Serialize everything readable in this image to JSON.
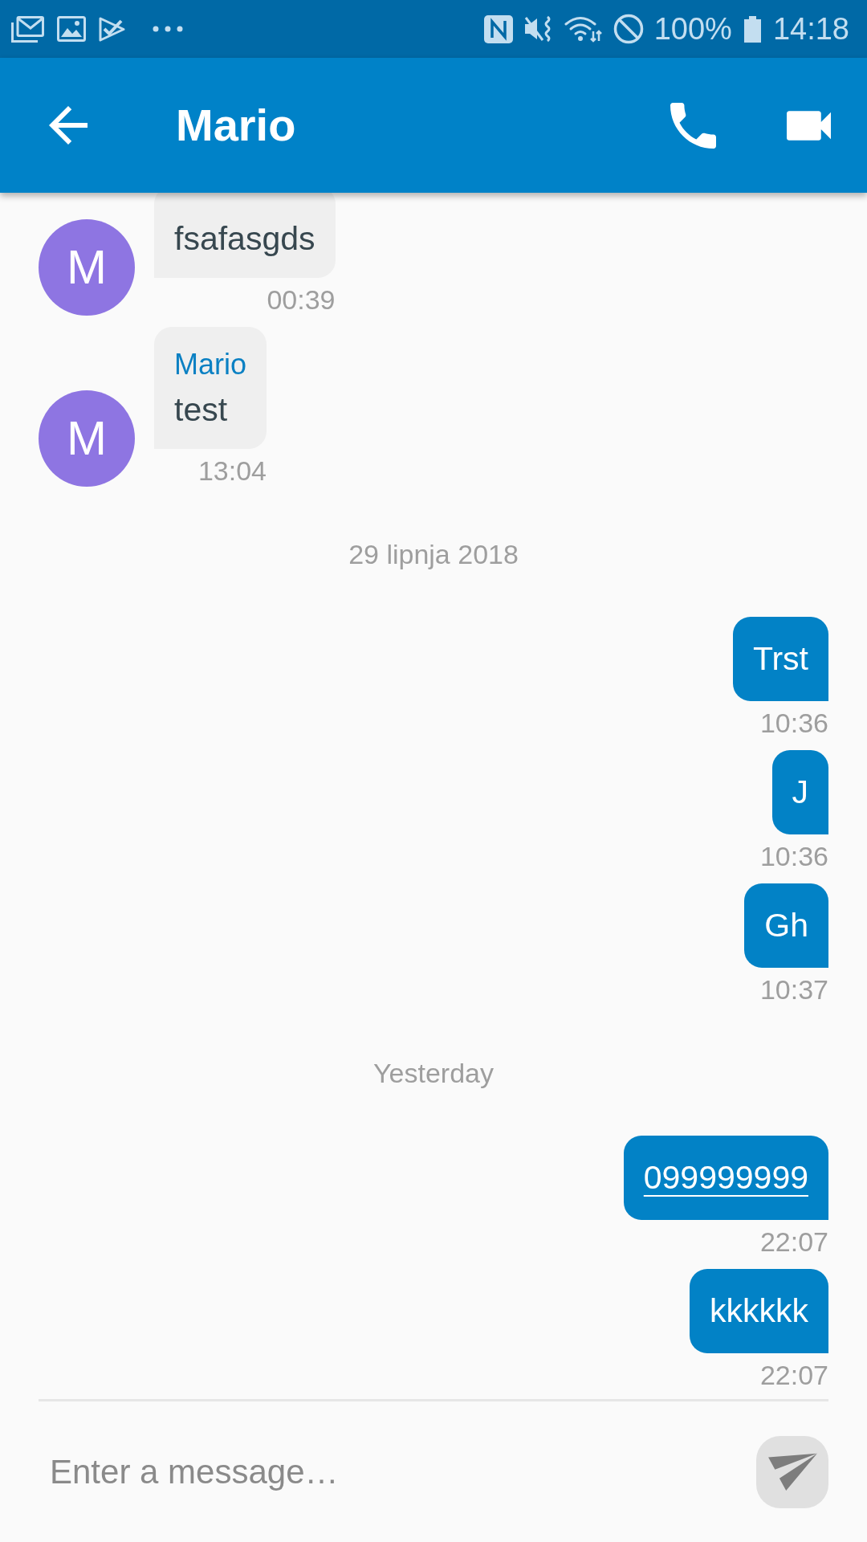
{
  "status_bar": {
    "battery": "100%",
    "time": "14:18"
  },
  "app_bar": {
    "title": "Mario"
  },
  "messages": [
    {
      "kind": "received",
      "avatar": "M",
      "text": "fsafasgds",
      "time": "00:39"
    },
    {
      "kind": "received",
      "avatar": "M",
      "sender": "Mario",
      "text": "test",
      "time": "13:04"
    },
    {
      "kind": "date",
      "text": "29 lipnja 2018"
    },
    {
      "kind": "sent",
      "text": "Trst",
      "time": "10:36",
      "link": false
    },
    {
      "kind": "sent",
      "text": "J",
      "time": "10:36",
      "link": false
    },
    {
      "kind": "sent",
      "text": "Gh",
      "time": "10:37",
      "link": false
    },
    {
      "kind": "date",
      "text": "Yesterday"
    },
    {
      "kind": "sent",
      "text": "099999999",
      "time": "22:07",
      "link": true
    },
    {
      "kind": "sent",
      "text": "kkkkkk",
      "time": "22:07",
      "link": false
    }
  ],
  "composer": {
    "placeholder": "Enter a message…"
  }
}
